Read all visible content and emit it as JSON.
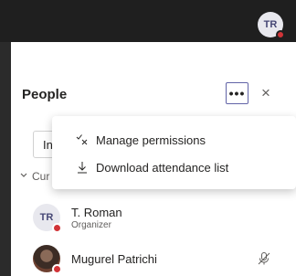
{
  "header": {
    "user_initials": "TR"
  },
  "panel": {
    "title": "People",
    "more_label": "•••",
    "close_label": "×",
    "invite_label": "In",
    "section_label": "Cur"
  },
  "menu": {
    "items": [
      {
        "label": "Manage permissions",
        "icon": "check-x-icon"
      },
      {
        "label": "Download attendance list",
        "icon": "download-icon"
      }
    ]
  },
  "participants": [
    {
      "initials": "TR",
      "name": "T. Roman",
      "role": "Organizer",
      "status": "busy"
    },
    {
      "name": "Mugurel Patrichi",
      "status": "busy",
      "mic": "muted"
    }
  ],
  "colors": {
    "accent": "#6264a7",
    "busy": "#d13438",
    "topbar": "#1f1f1f"
  }
}
